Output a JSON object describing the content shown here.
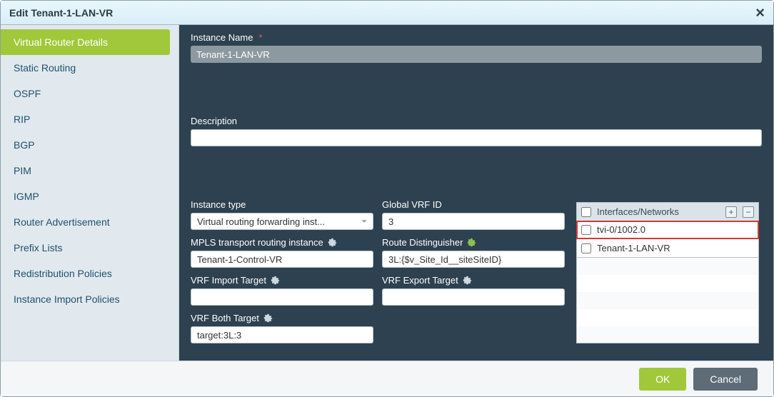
{
  "title": "Edit Tenant-1-LAN-VR",
  "sidebar": {
    "items": [
      {
        "label": "Virtual Router Details",
        "active": true
      },
      {
        "label": "Static Routing"
      },
      {
        "label": "OSPF"
      },
      {
        "label": "RIP"
      },
      {
        "label": "BGP"
      },
      {
        "label": "PIM"
      },
      {
        "label": "IGMP"
      },
      {
        "label": "Router Advertisement"
      },
      {
        "label": "Prefix Lists"
      },
      {
        "label": "Redistribution Policies"
      },
      {
        "label": "Instance Import Policies"
      }
    ]
  },
  "fields": {
    "instance_name": {
      "label": "Instance Name",
      "value": "Tenant-1-LAN-VR",
      "required": true
    },
    "description": {
      "label": "Description",
      "value": ""
    },
    "instance_type": {
      "label": "Instance type",
      "value": "Virtual routing forwarding inst..."
    },
    "global_vrf_id": {
      "label": "Global VRF ID",
      "value": "3"
    },
    "mpls_transport": {
      "label": "MPLS transport routing instance",
      "value": "Tenant-1-Control-VR"
    },
    "route_distinguisher": {
      "label": "Route Distinguisher",
      "value": "3L:{$v_Site_Id__siteSiteID}"
    },
    "vrf_import_target": {
      "label": "VRF Import Target",
      "value": ""
    },
    "vrf_export_target": {
      "label": "VRF Export Target",
      "value": ""
    },
    "vrf_both_target": {
      "label": "VRF Both Target",
      "value": "target:3L:3"
    }
  },
  "interfaces": {
    "header": "Interfaces/Networks",
    "rows": [
      {
        "label": "tvi-0/1002.0",
        "checked": false,
        "highlight": true
      },
      {
        "label": "Tenant-1-LAN-VR",
        "checked": false
      }
    ]
  },
  "footer": {
    "ok": "OK",
    "cancel": "Cancel"
  }
}
